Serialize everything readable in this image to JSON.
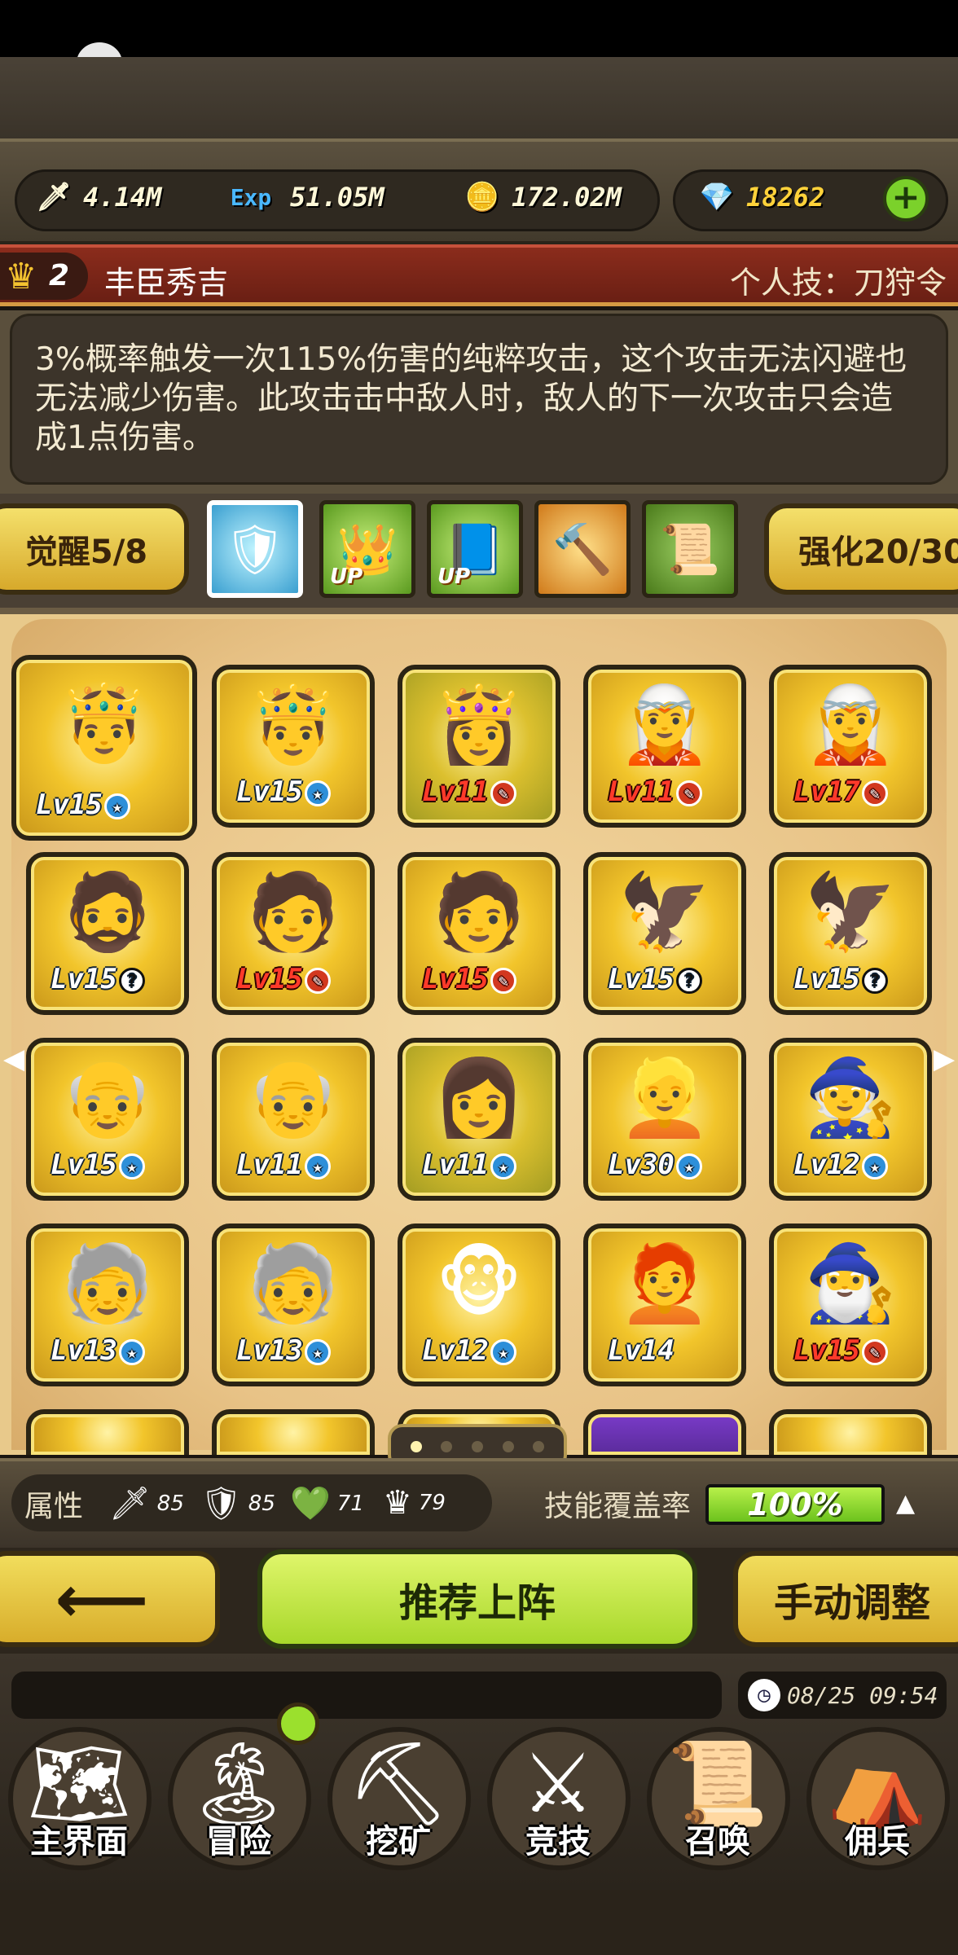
{
  "resources": {
    "attack": "4.14M",
    "exp": "51.05M",
    "gold": "172.02M",
    "gems": "18262"
  },
  "hero": {
    "rank": "2",
    "name": "丰臣秀吉",
    "skill": "个人技：刀狩令",
    "description": "3%概率触发一次115%伤害的纯粹攻击，这个攻击无法闪避也无法减少伤害。此攻击击中敌人时，敌人的下一次攻击只会造成1点伤害。"
  },
  "tabs": {
    "awaken": "觉醒5/8",
    "enhance": "强化20/30",
    "up_tag": "UP"
  },
  "cards": [
    {
      "lv": "Lv15",
      "badge": "★",
      "color": "blue",
      "face": "🤴"
    },
    {
      "lv": "Lv15",
      "badge": "★",
      "color": "blue",
      "face": "🤴"
    },
    {
      "lv": "Lv11",
      "badge": "✎",
      "color": "red",
      "face": "👸"
    },
    {
      "lv": "Lv11",
      "badge": "✎",
      "color": "red",
      "face": "🧝"
    },
    {
      "lv": "Lv17",
      "badge": "✎",
      "color": "red",
      "face": "🧝"
    },
    {
      "lv": "Lv15",
      "badge": "?",
      "color": "gray",
      "face": "🧔"
    },
    {
      "lv": "Lv15",
      "badge": "✎",
      "color": "red",
      "face": "🧑"
    },
    {
      "lv": "Lv15",
      "badge": "✎",
      "color": "red",
      "face": "🧑"
    },
    {
      "lv": "Lv15",
      "badge": "?",
      "color": "gray",
      "face": "🦅"
    },
    {
      "lv": "Lv15",
      "badge": "?",
      "color": "gray",
      "face": "🦅"
    },
    {
      "lv": "Lv15",
      "badge": "★",
      "color": "blue",
      "face": "👴"
    },
    {
      "lv": "Lv11",
      "badge": "★",
      "color": "blue",
      "face": "👴"
    },
    {
      "lv": "Lv11",
      "badge": "★",
      "color": "blue",
      "face": "👩"
    },
    {
      "lv": "Lv30",
      "badge": "★",
      "color": "blue",
      "face": "👱"
    },
    {
      "lv": "Lv12",
      "badge": "★",
      "color": "blue",
      "face": "🧙"
    },
    {
      "lv": "Lv13",
      "badge": "★",
      "color": "blue",
      "face": "🧓"
    },
    {
      "lv": "Lv13",
      "badge": "★",
      "color": "blue",
      "face": "🧓"
    },
    {
      "lv": "Lv12",
      "badge": "★",
      "color": "blue",
      "face": "🐵"
    },
    {
      "lv": "Lv14",
      "badge": "",
      "color": "blue",
      "face": "🧑‍🦰"
    },
    {
      "lv": "Lv15",
      "badge": "✎",
      "color": "red",
      "face": "🧙‍♂️"
    }
  ],
  "attributes": {
    "label": "属性",
    "sword": "85",
    "shield": "85",
    "gem": "71",
    "crown": "79",
    "coverage_label": "技能覆盖率",
    "coverage_value": "100%",
    "coverage_fraction": 1.0
  },
  "actions": {
    "back": "⟵",
    "recommend": "推荐上阵",
    "manual": "手动调整"
  },
  "clock": "08/25 09:54",
  "nav": {
    "home": "主界面",
    "adventure": "冒险",
    "mining": "挖矿",
    "arena": "竞技",
    "summon": "召唤",
    "mercenary": "佣兵"
  }
}
